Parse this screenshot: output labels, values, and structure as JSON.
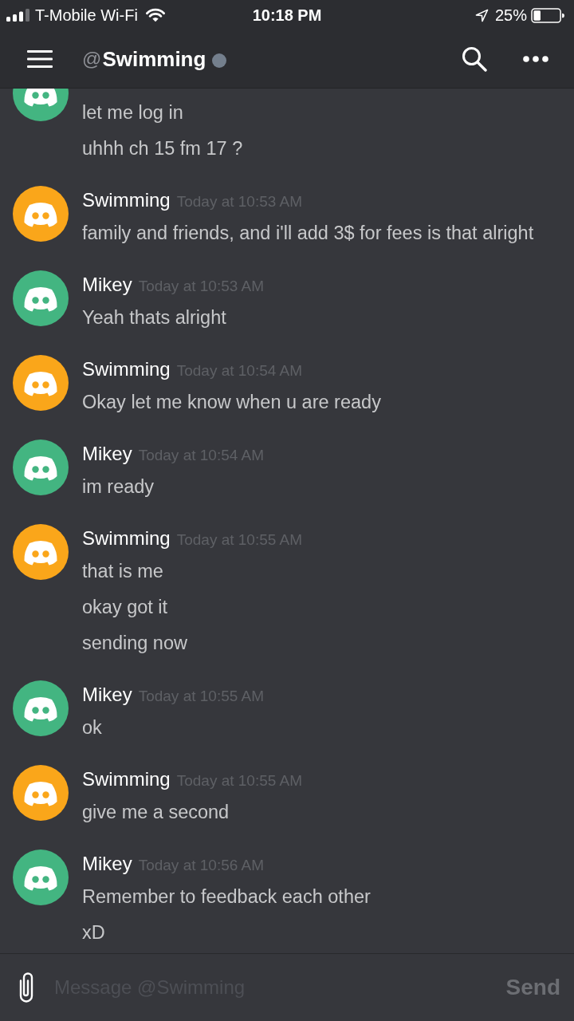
{
  "status_bar": {
    "carrier": "T-Mobile Wi-Fi",
    "time": "10:18 PM",
    "battery": "25%"
  },
  "header": {
    "prefix": "@",
    "title": "Swimming",
    "online": false
  },
  "messages": [
    {
      "color": "#43b581",
      "lines": [
        "let me log in",
        "uhhh ch 15 fm 17 ?"
      ]
    },
    {
      "author": "Swimming",
      "time": "Today at 10:53 AM",
      "color": "#faa61a",
      "lines": [
        "family and friends, and i'll add 3$ for fees is that alright"
      ]
    },
    {
      "author": "Mikey",
      "time": "Today at 10:53 AM",
      "color": "#43b581",
      "lines": [
        "Yeah thats alright"
      ]
    },
    {
      "author": "Swimming",
      "time": "Today at 10:54 AM",
      "color": "#faa61a",
      "lines": [
        "Okay let me know when u are ready"
      ]
    },
    {
      "author": "Mikey",
      "time": "Today at 10:54 AM",
      "color": "#43b581",
      "lines": [
        "im ready"
      ]
    },
    {
      "author": "Swimming",
      "time": "Today at 10:55 AM",
      "color": "#faa61a",
      "lines": [
        "that is me",
        "okay got it",
        "sending now"
      ]
    },
    {
      "author": "Mikey",
      "time": "Today at 10:55 AM",
      "color": "#43b581",
      "lines": [
        "ok"
      ]
    },
    {
      "author": "Swimming",
      "time": "Today at 10:55 AM",
      "color": "#faa61a",
      "lines": [
        "give me a second"
      ]
    },
    {
      "author": "Mikey",
      "time": "Today at 10:56 AM",
      "color": "#43b581",
      "lines": [
        "Remember to feedback each other",
        "xD"
      ]
    }
  ],
  "composer": {
    "placeholder": "Message @Swimming",
    "send": {
      "label": "Send",
      "disabled": true
    }
  }
}
